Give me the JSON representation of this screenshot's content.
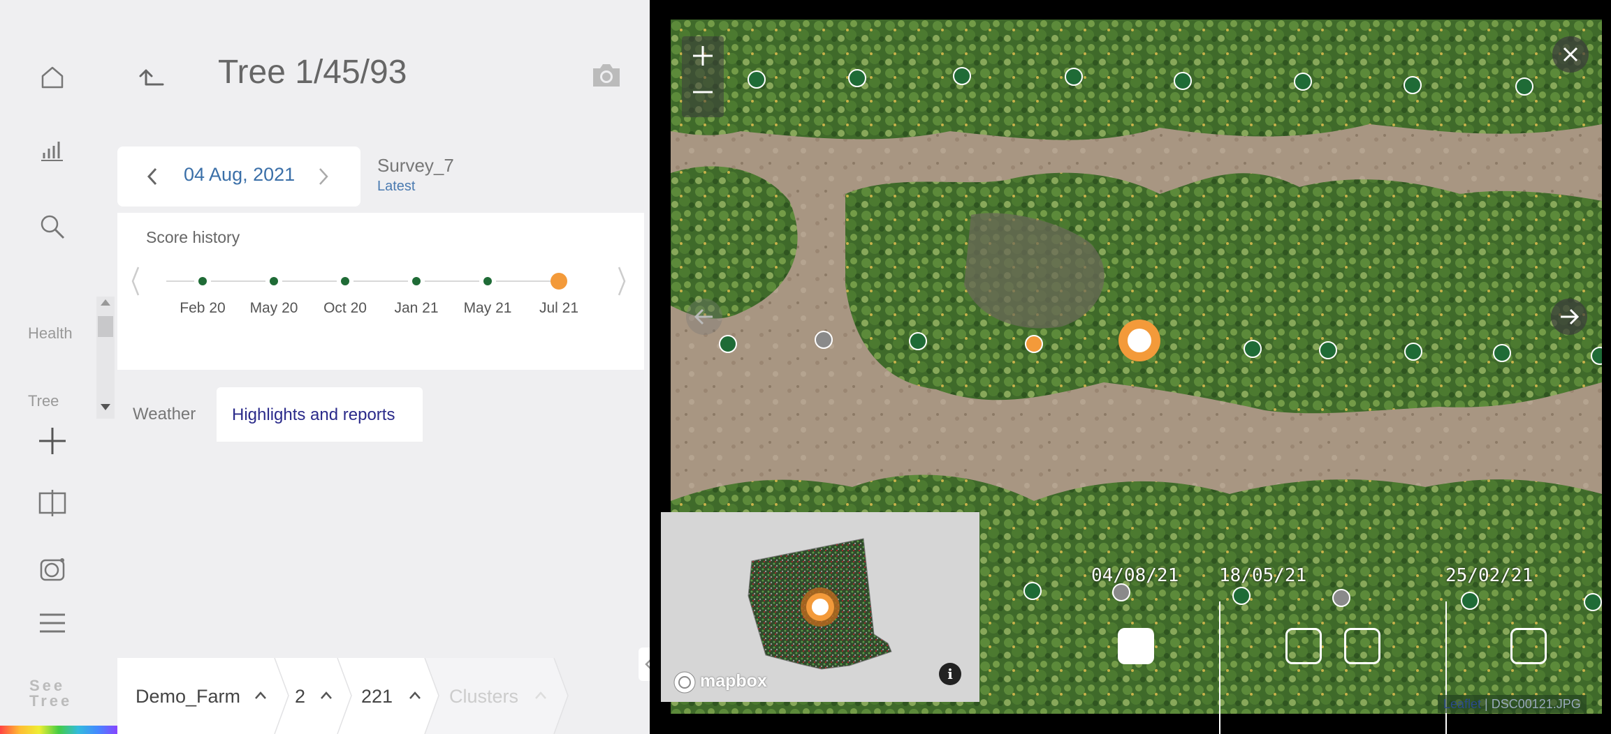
{
  "app": {
    "brand": "See Tree"
  },
  "header": {
    "title": "Tree 1/45/93"
  },
  "rail": {
    "items": [
      {
        "icon": "home-icon"
      },
      {
        "icon": "bar-chart-icon"
      },
      {
        "icon": "search-icon"
      },
      {
        "label": "Health"
      },
      {
        "label": "Tree Metrics"
      },
      {
        "icon": "plus-icon"
      },
      {
        "icon": "compare-icon"
      },
      {
        "icon": "camera-roll-icon"
      },
      {
        "icon": "menu-icon"
      }
    ]
  },
  "date_picker": {
    "date": "04 Aug, 2021"
  },
  "survey": {
    "name": "Survey_7",
    "tag": "Latest"
  },
  "score_history": {
    "title": "Score history",
    "points": [
      {
        "label": "Feb 20",
        "status": "good"
      },
      {
        "label": "May 20",
        "status": "good"
      },
      {
        "label": "Oct 20",
        "status": "good"
      },
      {
        "label": "Jan 21",
        "status": "good"
      },
      {
        "label": "May 21",
        "status": "good"
      },
      {
        "label": "Jul 21",
        "status": "warning"
      }
    ]
  },
  "tabs": {
    "weather": "Weather",
    "highlights": "Highlights and reports"
  },
  "breadcrumb": [
    {
      "label": "Demo_Farm",
      "active": true
    },
    {
      "label": "2",
      "active": true
    },
    {
      "label": "221",
      "active": true
    },
    {
      "label": "Clusters",
      "active": false
    }
  ],
  "map": {
    "zoom_in": "+",
    "zoom_out": "−",
    "attribution": {
      "leaflet": "Leaflet",
      "file": "DSC00121.JPG",
      "sep": " | "
    },
    "minimap": {
      "logo": "mapbox",
      "info": "i"
    },
    "timeline": [
      {
        "date": "04/08/21",
        "selected": true
      },
      {
        "date": "18/05/21",
        "selected": false
      },
      {
        "date": "25/02/21",
        "selected": false
      }
    ]
  },
  "colors": {
    "good": "#1f6b36",
    "warning": "#f39a3a",
    "neutral": "#8a8a8a",
    "accent": "#3a6fa8"
  }
}
